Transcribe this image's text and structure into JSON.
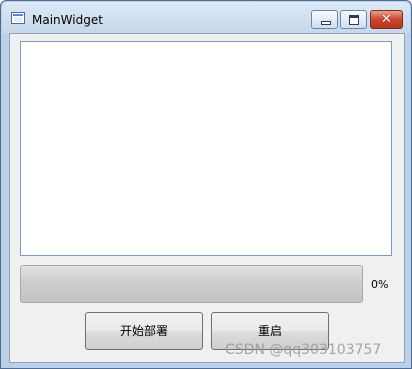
{
  "window": {
    "title": "MainWidget",
    "close_glyph": "✕"
  },
  "progress": {
    "value_percent": 0,
    "text": "0%"
  },
  "buttons": {
    "deploy": "开始部署",
    "restart": "重启"
  },
  "watermark": "CSDN @qq303103757"
}
